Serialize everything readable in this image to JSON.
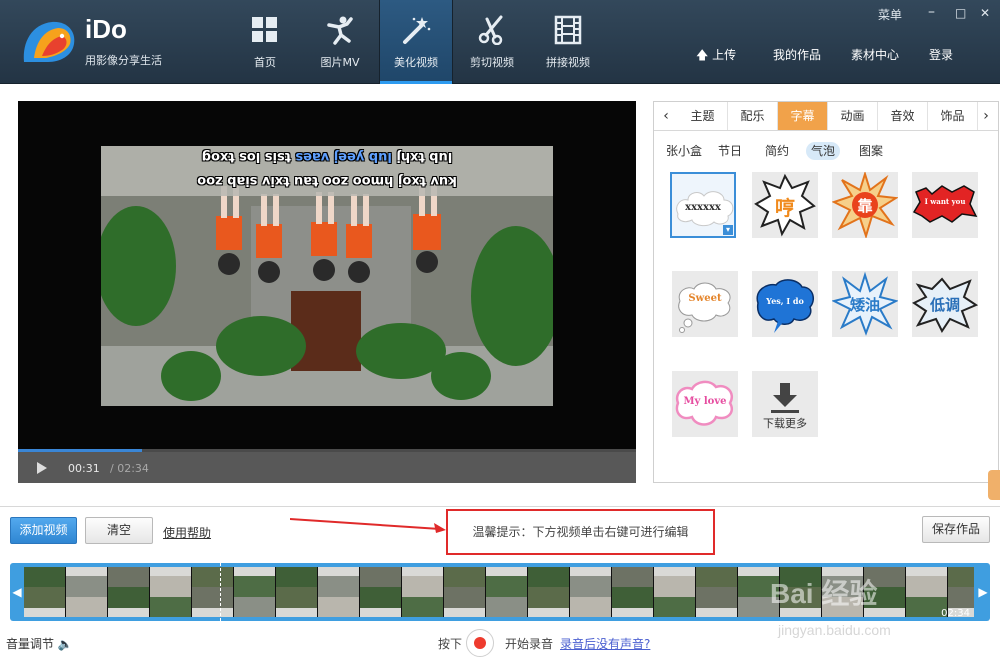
{
  "app": {
    "name": "iDo",
    "tagline": "用影像分享生活",
    "accent": "#2d9bf0"
  },
  "nav": [
    {
      "label": "首页",
      "icon": "grid-icon",
      "active": false
    },
    {
      "label": "图片MV",
      "icon": "dancer-icon",
      "active": false
    },
    {
      "label": "美化视频",
      "icon": "magic-wand-icon",
      "active": true
    },
    {
      "label": "剪切视频",
      "icon": "scissors-icon",
      "active": false
    },
    {
      "label": "拼接视频",
      "icon": "film-icon",
      "active": false
    }
  ],
  "top_links": {
    "upload": "上传",
    "my_works": "我的作品",
    "materials": "素材中心",
    "login": "登录",
    "menu": "菜单"
  },
  "player": {
    "subtitle_line1_a": "lub txhj",
    "subtitle_line1_b": "lub yeej vaes",
    "subtitle_line1_c": "tsis los txog",
    "subtitle_line2": "kuv txoj hmoo zoo tau txiv siab zoo",
    "current_time": "00:31",
    "separator_total": "/ 02:34",
    "progress": 0.2
  },
  "panel": {
    "tabs": [
      "主题",
      "配乐",
      "字幕",
      "动画",
      "音效",
      "饰品"
    ],
    "active_tab": "字幕",
    "sub_tabs": [
      "张小盒",
      "节日",
      "简约",
      "气泡",
      "图案"
    ],
    "active_sub_tab": "气泡",
    "stickers": [
      {
        "icon": "cloud-bubble-icon",
        "text": "xxxxxx",
        "selected": true
      },
      {
        "icon": "spiky-bubble-icon",
        "text": "哼"
      },
      {
        "icon": "explosion-bubble-icon",
        "text": "靠"
      },
      {
        "icon": "red-banner-icon",
        "text": "I want you"
      },
      {
        "icon": "thought-cloud-icon",
        "text": "Sweet"
      },
      {
        "icon": "blue-bubble-icon",
        "text": "Yes, I do"
      },
      {
        "icon": "star-bubble-icon",
        "text": "矮油"
      },
      {
        "icon": "jagged-bubble-icon",
        "text": "低调"
      },
      {
        "icon": "pink-cloud-icon",
        "text": "My love"
      }
    ],
    "download_more": "下载更多"
  },
  "bottom": {
    "add_video": "添加视频",
    "clear": "清空",
    "help": "使用帮助",
    "tip": "温馨提示：下方视频单击右键可进行编辑",
    "save": "保存作品",
    "timeline_duration": "02:34",
    "volume": "音量调节",
    "press": "按下",
    "start_record": "开始录音",
    "no_sound_help": "录音后没有声音?"
  },
  "watermark": {
    "brand": "Bai 经验",
    "url": "jingyan.baidu.com"
  }
}
